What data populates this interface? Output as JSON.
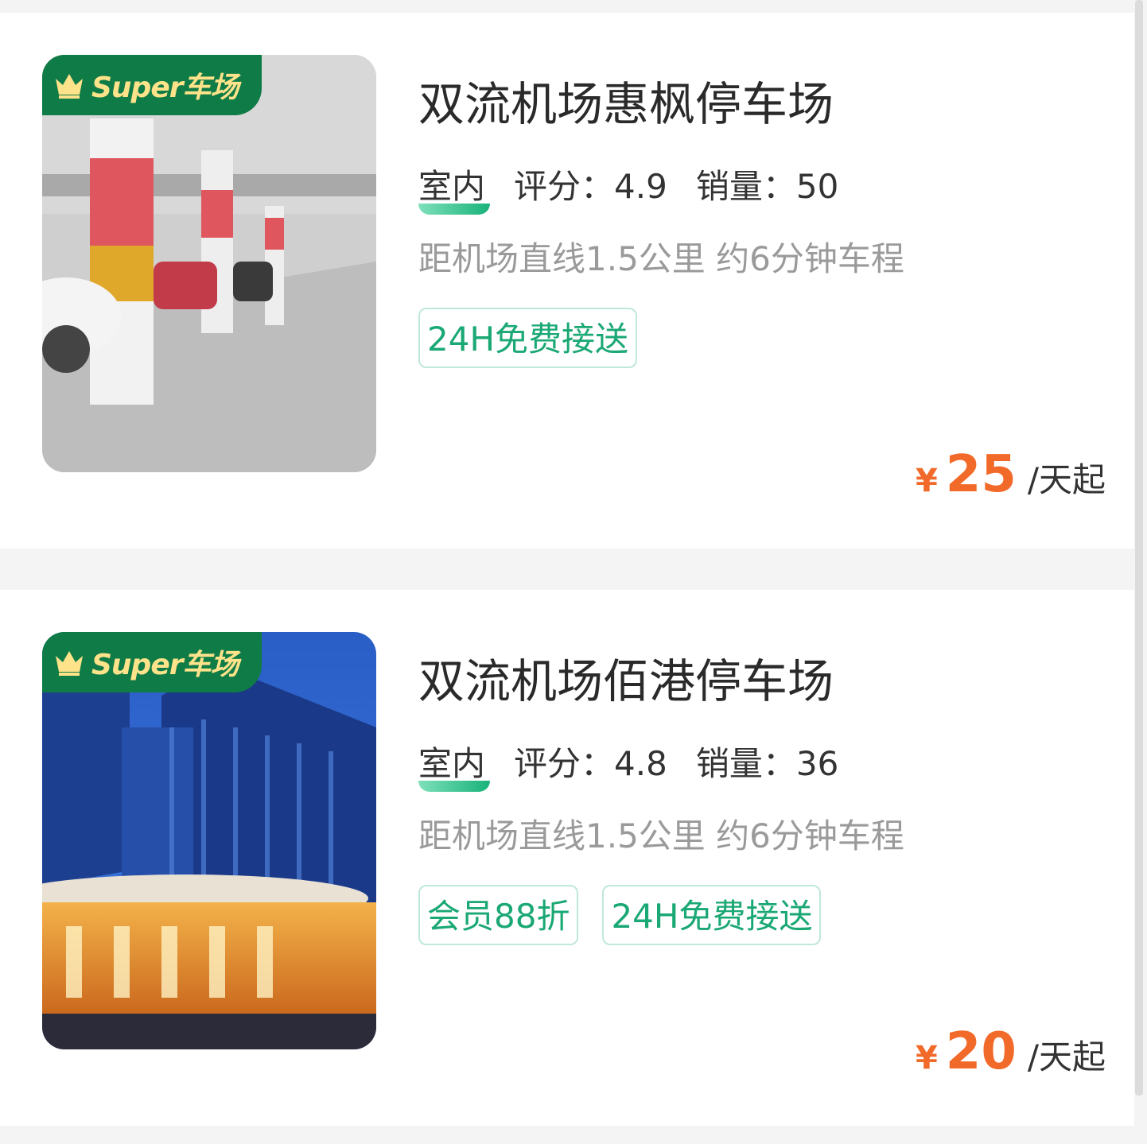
{
  "badge_label": "Super车场",
  "cards": [
    {
      "title": "双流机场惠枫停车场",
      "type": "室内",
      "rating_label": "评分：",
      "rating": "4.9",
      "sales_label": "销量：",
      "sales": "50",
      "distance": "距机场直线1.5公里 约6分钟车程",
      "tags": [
        "24H免费接送"
      ],
      "currency": "¥",
      "price": "25",
      "price_unit": "/天起"
    },
    {
      "title": "双流机场佰港停车场",
      "type": "室内",
      "rating_label": "评分：",
      "rating": "4.8",
      "sales_label": "销量：",
      "sales": "36",
      "distance": "距机场直线1.5公里 约6分钟车程",
      "tags": [
        "会员88折",
        "24H免费接送"
      ],
      "currency": "¥",
      "price": "20",
      "price_unit": "/天起"
    }
  ],
  "colors": {
    "accent_green": "#1aa874",
    "badge_green": "#0f7b46",
    "price_orange": "#f26a2a"
  },
  "icons": [
    "crown-icon"
  ]
}
